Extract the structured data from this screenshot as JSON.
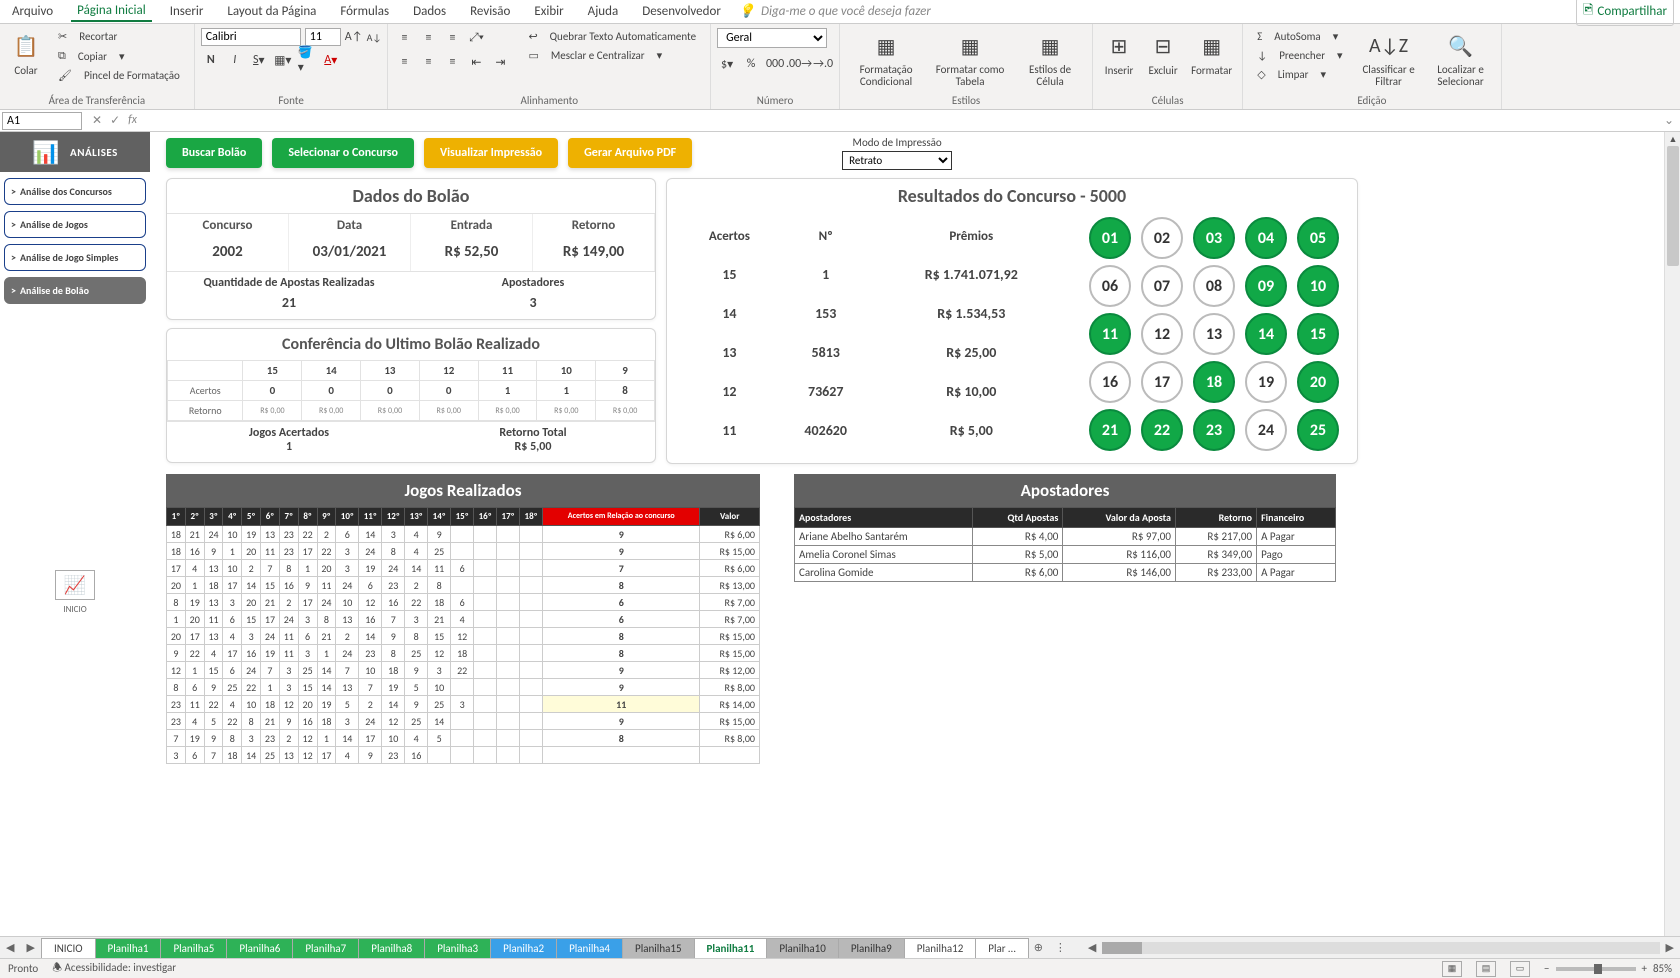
{
  "menu": {
    "tabs": [
      "Arquivo",
      "Página Inicial",
      "Inserir",
      "Layout da Página",
      "Fórmulas",
      "Dados",
      "Revisão",
      "Exibir",
      "Ajuda",
      "Desenvolvedor"
    ],
    "active": 1,
    "tellme": "Diga-me o que você deseja fazer",
    "share": "Compartilhar"
  },
  "ribbon": {
    "clipboard": {
      "paste": "Colar",
      "cut": "Recortar",
      "copy": "Copiar",
      "painter": "Pincel de Formatação",
      "group": "Área de Transferência"
    },
    "font": {
      "name": "Calibri",
      "size": "11",
      "group": "Fonte"
    },
    "align": {
      "wrap": "Quebrar Texto Automaticamente",
      "merge": "Mesclar e Centralizar",
      "group": "Alinhamento"
    },
    "number": {
      "format": "Geral",
      "group": "Número"
    },
    "styles": {
      "cond": "Formatação Condicional",
      "table": "Formatar como Tabela",
      "cell": "Estilos de Célula",
      "group": "Estilos"
    },
    "cells": {
      "insert": "Inserir",
      "delete": "Excluir",
      "format": "Formatar",
      "group": "Células"
    },
    "editing": {
      "autosum": "AutoSoma",
      "fill": "Preencher",
      "clear": "Limpar",
      "sort": "Classificar e Filtrar",
      "find": "Localizar e Selecionar",
      "group": "Edição"
    }
  },
  "formula": {
    "namebox": "A1",
    "fx": "fx"
  },
  "sidebar": {
    "title": "ANÁLISES",
    "buttons": [
      "Análise dos Concursos",
      "Análise de Jogos",
      "Análise de Jogo Simples",
      "Análise de Bolão"
    ],
    "active": 3,
    "inicio": "INICIO"
  },
  "actions": {
    "buscar": "Buscar Bolão",
    "selecionar": "Selecionar o Concurso",
    "visualizar": "Visualizar Impressão",
    "gerar": "Gerar Arquivo PDF",
    "printmode_label": "Modo de Impressão",
    "printmode_value": "Retrato"
  },
  "dados": {
    "title": "Dados do Bolão",
    "labels": {
      "concurso": "Concurso",
      "data": "Data",
      "entrada": "Entrada",
      "retorno": "Retorno",
      "qtd": "Quantidade de Apostas Realizadas",
      "apost": "Apostadores"
    },
    "concurso": "2002",
    "data": "03/01/2021",
    "entrada": "R$ 52,50",
    "retorno": "R$ 149,00",
    "qtd": "21",
    "apost": "3"
  },
  "conf": {
    "title": "Conferência do Ultimo Bolão Realizado",
    "cols": [
      "15",
      "14",
      "13",
      "12",
      "11",
      "10",
      "9"
    ],
    "rows": {
      "acertos_label": "Acertos",
      "acertos": [
        "0",
        "0",
        "0",
        "0",
        "1",
        "1",
        "8"
      ],
      "retorno_label": "Retorno",
      "retorno": [
        "R$ 0,00",
        "R$ 0,00",
        "R$ 0,00",
        "R$ 0,00",
        "R$ 0,00",
        "R$ 0,00",
        "R$ 0,00"
      ]
    },
    "jogos_label": "Jogos Acertados",
    "jogos_val": "1",
    "rettot_label": "Retorno Total",
    "rettot_val": "R$ 5,00"
  },
  "results": {
    "title": "Resultados do Concurso - 5000",
    "headers": {
      "acertos": "Acertos",
      "n": "Nº",
      "premios": "Prêmios"
    },
    "rows": [
      {
        "ac": "15",
        "n": "1",
        "p": "R$ 1.741.071,92"
      },
      {
        "ac": "14",
        "n": "153",
        "p": "R$ 1.534,53"
      },
      {
        "ac": "13",
        "n": "5813",
        "p": "R$ 25,00"
      },
      {
        "ac": "12",
        "n": "73627",
        "p": "R$ 10,00"
      },
      {
        "ac": "11",
        "n": "402620",
        "p": "R$ 5,00"
      }
    ],
    "balls": [
      {
        "n": "01",
        "h": true
      },
      {
        "n": "02",
        "h": false
      },
      {
        "n": "03",
        "h": true
      },
      {
        "n": "04",
        "h": true
      },
      {
        "n": "05",
        "h": true
      },
      {
        "n": "06",
        "h": false
      },
      {
        "n": "07",
        "h": false
      },
      {
        "n": "08",
        "h": false
      },
      {
        "n": "09",
        "h": true
      },
      {
        "n": "10",
        "h": true
      },
      {
        "n": "11",
        "h": true
      },
      {
        "n": "12",
        "h": false
      },
      {
        "n": "13",
        "h": false
      },
      {
        "n": "14",
        "h": true
      },
      {
        "n": "15",
        "h": true
      },
      {
        "n": "16",
        "h": false
      },
      {
        "n": "17",
        "h": false
      },
      {
        "n": "18",
        "h": true
      },
      {
        "n": "19",
        "h": false
      },
      {
        "n": "20",
        "h": true
      },
      {
        "n": "21",
        "h": true
      },
      {
        "n": "22",
        "h": true
      },
      {
        "n": "23",
        "h": true
      },
      {
        "n": "24",
        "h": false
      },
      {
        "n": "25",
        "h": true
      }
    ]
  },
  "jogos": {
    "title": "Jogos Realizados",
    "headers": [
      "1º",
      "2º",
      "3º",
      "4º",
      "5º",
      "6º",
      "7º",
      "8º",
      "9º",
      "10º",
      "11º",
      "12º",
      "13º",
      "14º",
      "15º",
      "16º",
      "17º",
      "18º"
    ],
    "acertos_hdr": "Acertos em Relação ao concurso",
    "valor_hdr": "Valor",
    "rows": [
      {
        "c": [
          "18",
          "21",
          "24",
          "10",
          "19",
          "13",
          "23",
          "22",
          "2",
          "6",
          "14",
          "3",
          "4",
          "9",
          "",
          "",
          "",
          ""
        ],
        "ac": "9",
        "v": "R$ 6,00"
      },
      {
        "c": [
          "18",
          "16",
          "9",
          "1",
          "20",
          "11",
          "23",
          "17",
          "22",
          "3",
          "24",
          "8",
          "4",
          "25",
          "",
          "",
          "",
          ""
        ],
        "ac": "9",
        "v": "R$ 15,00"
      },
      {
        "c": [
          "17",
          "4",
          "13",
          "10",
          "2",
          "7",
          "8",
          "1",
          "20",
          "3",
          "19",
          "24",
          "14",
          "11",
          "6",
          "",
          "",
          ""
        ],
        "ac": "7",
        "v": "R$ 6,00"
      },
      {
        "c": [
          "20",
          "1",
          "18",
          "17",
          "14",
          "15",
          "16",
          "9",
          "11",
          "24",
          "6",
          "23",
          "2",
          "8",
          "",
          "",
          "",
          ""
        ],
        "ac": "8",
        "v": "R$ 13,00"
      },
      {
        "c": [
          "8",
          "19",
          "13",
          "3",
          "20",
          "21",
          "2",
          "17",
          "24",
          "10",
          "12",
          "16",
          "22",
          "18",
          "6",
          "",
          "",
          ""
        ],
        "ac": "6",
        "v": "R$ 7,00"
      },
      {
        "c": [
          "1",
          "20",
          "11",
          "6",
          "15",
          "17",
          "24",
          "3",
          "8",
          "13",
          "16",
          "7",
          "3",
          "21",
          "4",
          "",
          "",
          ""
        ],
        "ac": "6",
        "v": "R$ 7,00"
      },
      {
        "c": [
          "20",
          "17",
          "13",
          "4",
          "3",
          "24",
          "11",
          "6",
          "21",
          "2",
          "14",
          "9",
          "8",
          "15",
          "12",
          "",
          "",
          ""
        ],
        "ac": "8",
        "v": "R$ 15,00"
      },
      {
        "c": [
          "9",
          "22",
          "4",
          "17",
          "16",
          "19",
          "11",
          "3",
          "1",
          "24",
          "23",
          "8",
          "25",
          "12",
          "18",
          "",
          "",
          ""
        ],
        "ac": "8",
        "v": "R$ 15,00"
      },
      {
        "c": [
          "12",
          "1",
          "15",
          "6",
          "24",
          "7",
          "3",
          "25",
          "14",
          "7",
          "10",
          "18",
          "9",
          "3",
          "22",
          "",
          "",
          ""
        ],
        "ac": "9",
        "v": "R$ 12,00"
      },
      {
        "c": [
          "8",
          "6",
          "9",
          "25",
          "22",
          "1",
          "3",
          "15",
          "14",
          "13",
          "7",
          "19",
          "5",
          "10",
          "",
          "",
          "",
          ""
        ],
        "ac": "9",
        "v": "R$ 8,00"
      },
      {
        "c": [
          "23",
          "11",
          "22",
          "4",
          "10",
          "18",
          "12",
          "20",
          "19",
          "5",
          "2",
          "14",
          "9",
          "25",
          "3",
          "",
          "",
          ""
        ],
        "ac": "11",
        "v": "R$ 14,00",
        "hl": true
      },
      {
        "c": [
          "23",
          "4",
          "5",
          "22",
          "8",
          "21",
          "9",
          "16",
          "18",
          "3",
          "24",
          "12",
          "25",
          "14",
          "",
          "",
          "",
          ""
        ],
        "ac": "9",
        "v": "R$ 15,00"
      },
      {
        "c": [
          "7",
          "19",
          "9",
          "8",
          "3",
          "23",
          "2",
          "12",
          "1",
          "14",
          "17",
          "10",
          "4",
          "5",
          "",
          "",
          "",
          ""
        ],
        "ac": "8",
        "v": "R$ 8,00"
      },
      {
        "c": [
          "3",
          "6",
          "7",
          "18",
          "14",
          "25",
          "13",
          "12",
          "17",
          "4",
          "9",
          "23",
          "16",
          "",
          "",
          "",
          "",
          ""
        ],
        "ac": "",
        "v": ""
      }
    ]
  },
  "apost": {
    "title": "Apostadores",
    "headers": [
      "Apostadores",
      "Qtd Apostas",
      "Valor da Aposta",
      "Retorno",
      "Financeiro"
    ],
    "rows": [
      [
        "Ariane Abelho Santarém",
        "",
        "R$ 4,00",
        "R$ 97,00",
        "R$ 217,00",
        "A Pagar"
      ],
      [
        "Amelia Coronel Simas",
        "",
        "R$ 5,00",
        "R$ 116,00",
        "R$ 349,00",
        "Pago"
      ],
      [
        "Carolina Gomide",
        "",
        "R$ 6,00",
        "R$ 146,00",
        "R$ 233,00",
        "A Pagar"
      ]
    ]
  },
  "sheets": {
    "list": [
      {
        "name": "INICIO",
        "cls": ""
      },
      {
        "name": "Planilha1",
        "cls": "green"
      },
      {
        "name": "Planilha5",
        "cls": "green"
      },
      {
        "name": "Planilha6",
        "cls": "green"
      },
      {
        "name": "Planilha7",
        "cls": "green"
      },
      {
        "name": "Planilha8",
        "cls": "green"
      },
      {
        "name": "Planilha3",
        "cls": "green"
      },
      {
        "name": "Planilha2",
        "cls": "blue"
      },
      {
        "name": "Planilha4",
        "cls": "blue"
      },
      {
        "name": "Planilha15",
        "cls": "gray"
      },
      {
        "name": "Planilha11",
        "cls": "active"
      },
      {
        "name": "Planilha10",
        "cls": "gray"
      },
      {
        "name": "Planilha9",
        "cls": "gray"
      },
      {
        "name": "Planilha12",
        "cls": ""
      },
      {
        "name": "Plar …",
        "cls": ""
      }
    ]
  },
  "status": {
    "ready": "Pronto",
    "access": "Acessibilidade: investigar",
    "zoom": "85%"
  }
}
